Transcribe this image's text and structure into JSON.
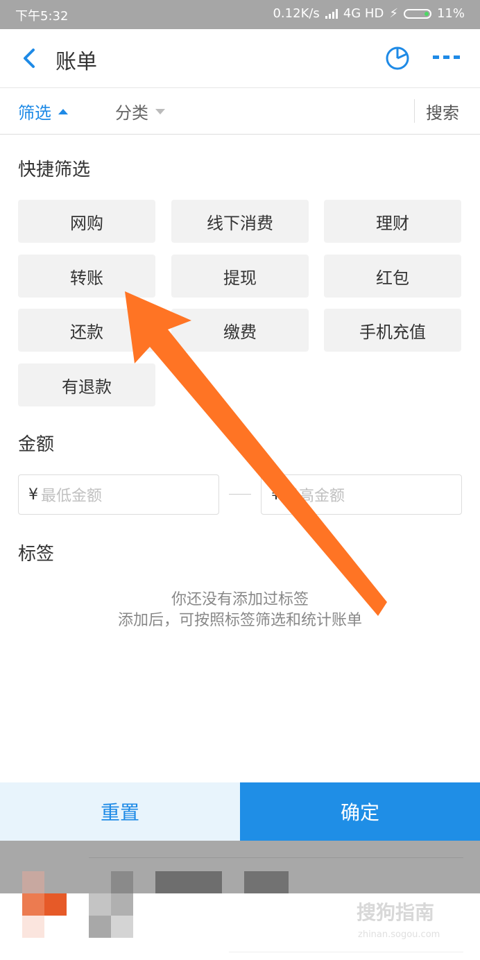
{
  "status_bar": {
    "time": "下午5:32",
    "speed": "0.12K/s",
    "network": "4G HD",
    "battery": "11%"
  },
  "header": {
    "back_icon": "chevron-left-icon",
    "title": "账单",
    "chart_icon": "pie-chart-icon",
    "more_icon": "more-dots-icon",
    "accent": "#1e8ae6"
  },
  "filter_bar": {
    "filter_tab": "筛选",
    "category_tab": "分类",
    "search_tab": "搜索"
  },
  "quick_filter": {
    "title": "快捷筛选",
    "chips": [
      "网购",
      "线下消费",
      "理财",
      "转账",
      "提现",
      "红包",
      "还款",
      "缴费",
      "手机充值",
      "有退款"
    ]
  },
  "amount": {
    "title": "金额",
    "min_symbol": "¥",
    "min_placeholder": "最低金额",
    "max_symbol": "¥",
    "max_placeholder": "最高金额"
  },
  "tags": {
    "title": "标签",
    "empty_line1": "你还没有添加过标签",
    "empty_line2": "添加后，可按照标签筛选和统计账单"
  },
  "buttons": {
    "reset": "重置",
    "confirm": "确定"
  },
  "watermark": {
    "text": "搜狗指南",
    "sub": "zhinan.sogou.com"
  }
}
